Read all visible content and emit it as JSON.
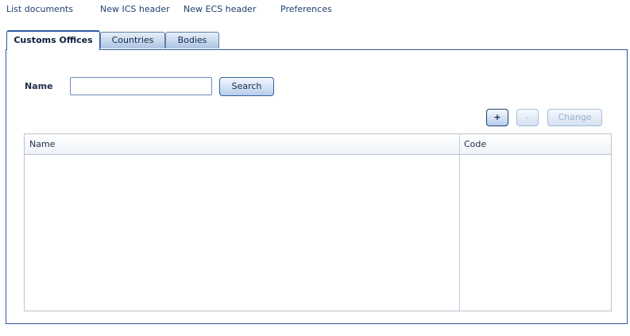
{
  "nav": {
    "items": [
      {
        "label": "List documents"
      },
      {
        "label": "New ICS header"
      },
      {
        "label": "New ECS header"
      },
      {
        "label": "Preferences"
      }
    ]
  },
  "tabs": [
    {
      "label": "Customs Offices",
      "active": true
    },
    {
      "label": "Countries",
      "active": false
    },
    {
      "label": "Bodies",
      "active": false
    }
  ],
  "search": {
    "label": "Name",
    "value": "",
    "button_label": "Search"
  },
  "toolbar": {
    "add_label": "+",
    "remove_label": "-",
    "change_label": "Change"
  },
  "table": {
    "columns": [
      {
        "label": "Name"
      },
      {
        "label": "Code"
      }
    ],
    "rows": []
  },
  "colors": {
    "accent": "#2e5aa0",
    "nav_link": "#1f3f6e",
    "disabled_text": "#9fb1cb"
  }
}
